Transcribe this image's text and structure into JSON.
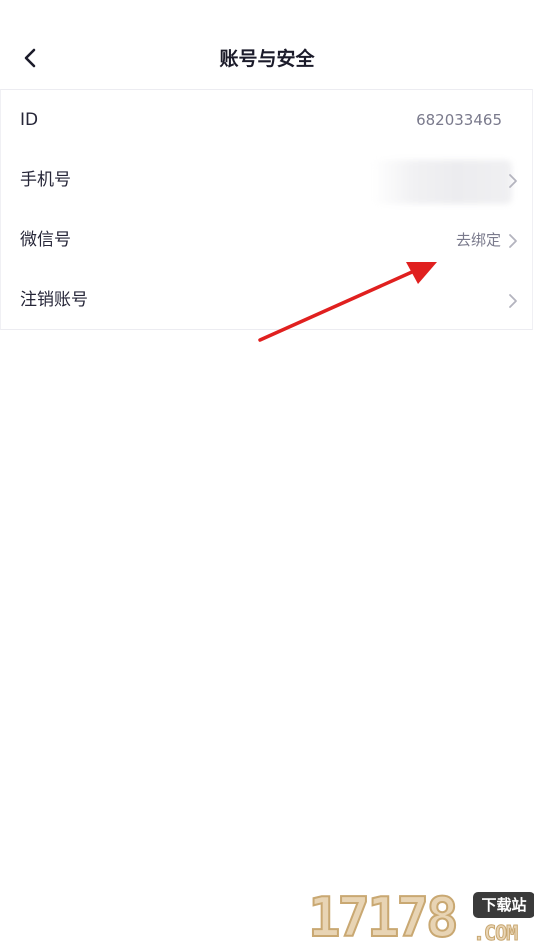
{
  "header": {
    "title": "账号与安全",
    "back_icon": "chevron-left-icon"
  },
  "rows": [
    {
      "label": "ID",
      "value": "682033465",
      "has_chevron": false
    },
    {
      "label": "手机号",
      "value": "",
      "has_chevron": true
    },
    {
      "label": "微信号",
      "value": "去绑定",
      "has_chevron": true
    },
    {
      "label": "注销账号",
      "value": "",
      "has_chevron": true
    }
  ],
  "annotation": {
    "arrow_color": "#e0201f"
  },
  "watermark": {
    "digits": "17178",
    "badge": "下载站",
    "suffix": ".COM"
  }
}
